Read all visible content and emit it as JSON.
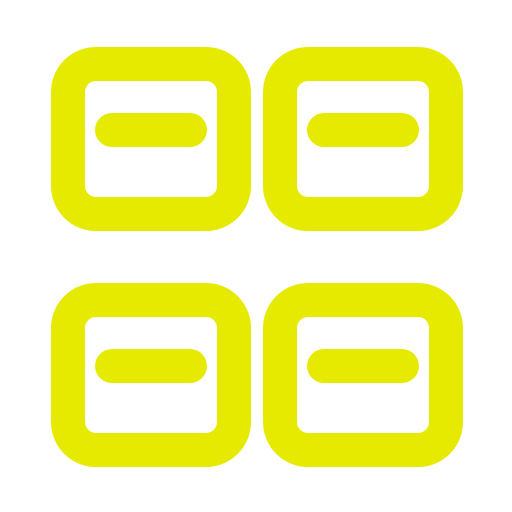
{
  "icon": {
    "name": "grid-minus-icon",
    "tiles": [
      {
        "name": "tile-top-left-minus-icon"
      },
      {
        "name": "tile-top-right-minus-icon"
      },
      {
        "name": "tile-bottom-left-minus-icon"
      },
      {
        "name": "tile-bottom-right-minus-icon"
      }
    ]
  },
  "colors": {
    "stroke": "#e6ea00",
    "background": "#ffffff"
  }
}
